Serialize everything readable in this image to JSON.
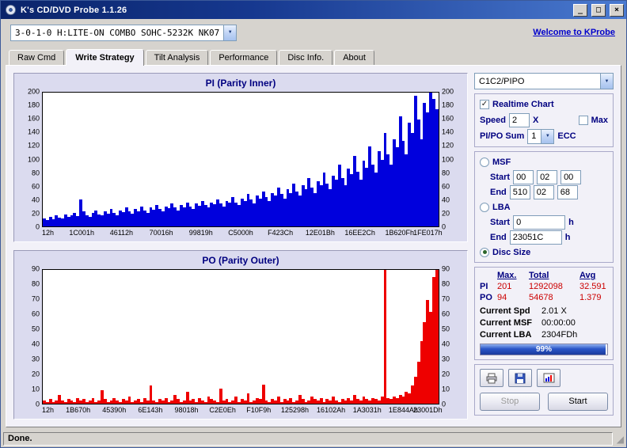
{
  "window": {
    "title": "K's CD/DVD Probe 1.1.26",
    "buttons": {
      "minimize": "_",
      "maximize": "□",
      "close": "×"
    }
  },
  "toolbar": {
    "drive_combo": "3-0-1-0 H:LITE-ON COMBO SOHC-5232K NK07",
    "welcome_link": "Welcome to KProbe"
  },
  "tabs": [
    {
      "label": "Raw Cmd",
      "active": false
    },
    {
      "label": "Write Strategy",
      "active": true
    },
    {
      "label": "Tilt Analysis",
      "active": false
    },
    {
      "label": "Performance",
      "active": false
    },
    {
      "label": "Disc Info.",
      "active": false
    },
    {
      "label": "About",
      "active": false
    }
  ],
  "chart_data": [
    {
      "type": "bar",
      "title": "PI (Parity Inner)",
      "color": "#0000dd",
      "ylim": [
        0,
        200
      ],
      "ytick_step": 20,
      "x_labels": [
        "12h",
        "1C001h",
        "46112h",
        "70016h",
        "99819h",
        "C5000h",
        "F423Ch",
        "12E01Bh",
        "16EE2Ch",
        "1B620Fh",
        "1FE017h"
      ],
      "values": [
        12,
        10,
        14,
        11,
        16,
        13,
        12,
        18,
        14,
        16,
        20,
        15,
        40,
        22,
        17,
        14,
        20,
        24,
        18,
        16,
        22,
        19,
        26,
        20,
        17,
        24,
        21,
        28,
        22,
        19,
        26,
        23,
        30,
        24,
        20,
        28,
        25,
        32,
        26,
        22,
        30,
        27,
        34,
        28,
        24,
        32,
        29,
        36,
        30,
        26,
        34,
        31,
        38,
        32,
        28,
        36,
        33,
        40,
        34,
        30,
        38,
        35,
        44,
        36,
        32,
        42,
        38,
        48,
        40,
        34,
        46,
        42,
        52,
        44,
        38,
        50,
        46,
        58,
        48,
        42,
        56,
        50,
        64,
        52,
        46,
        62,
        56,
        72,
        58,
        50,
        68,
        62,
        80,
        64,
        56,
        76,
        70,
        92,
        72,
        62,
        86,
        78,
        105,
        82,
        70,
        98,
        88,
        120,
        92,
        80,
        112,
        100,
        140,
        108,
        92,
        130,
        118,
        165,
        128,
        108,
        155,
        140,
        195,
        160,
        130,
        185,
        170,
        200,
        190,
        175
      ]
    },
    {
      "type": "bar",
      "title": "PO (Parity Outer)",
      "color": "#ee0000",
      "ylim": [
        0,
        90
      ],
      "ytick_step": 10,
      "x_labels": [
        "12h",
        "1B670h",
        "45390h",
        "6E143h",
        "98018h",
        "C2E0Eh",
        "F10F9h",
        "125298h",
        "16102Ah",
        "1A3031h",
        "1E844Ah",
        "23001Dh"
      ],
      "values": [
        2,
        1,
        3,
        1,
        2,
        6,
        2,
        1,
        3,
        2,
        1,
        4,
        2,
        3,
        1,
        2,
        4,
        1,
        2,
        9,
        3,
        1,
        2,
        4,
        2,
        1,
        3,
        2,
        5,
        1,
        2,
        3,
        1,
        4,
        2,
        12,
        2,
        1,
        3,
        2,
        4,
        1,
        2,
        6,
        3,
        1,
        2,
        8,
        2,
        3,
        1,
        4,
        2,
        1,
        5,
        3,
        2,
        1,
        10,
        2,
        3,
        1,
        2,
        5,
        1,
        3,
        2,
        7,
        1,
        2,
        4,
        3,
        13,
        2,
        1,
        3,
        2,
        5,
        1,
        3,
        2,
        4,
        1,
        2,
        6,
        3,
        1,
        2,
        5,
        3,
        2,
        4,
        1,
        3,
        2,
        5,
        2,
        1,
        3,
        2,
        4,
        2,
        6,
        3,
        2,
        5,
        3,
        2,
        4,
        3,
        2,
        5,
        90,
        4,
        3,
        5,
        4,
        6,
        5,
        8,
        7,
        12,
        18,
        28,
        42,
        55,
        70,
        62,
        85,
        90
      ]
    }
  ],
  "sidebar": {
    "mode_combo": "C1C2/PIPO",
    "realtime_chart": {
      "label": "Realtime Chart",
      "checked": true
    },
    "speed": {
      "label": "Speed",
      "value": "2",
      "unit": "X",
      "max_label": "Max",
      "max_checked": false
    },
    "pipo_sum": {
      "label": "PI/PO Sum",
      "value": "1",
      "unit": "ECC"
    },
    "msf": {
      "label": "MSF",
      "selected": false,
      "start_label": "Start",
      "end_label": "End",
      "start": [
        "00",
        "02",
        "00"
      ],
      "end": [
        "510",
        "02",
        "68"
      ]
    },
    "lba": {
      "label": "LBA",
      "selected": false,
      "start_label": "Start",
      "end_label": "End",
      "start": "0",
      "end": "23051C",
      "unit": "h"
    },
    "disc_size": {
      "label": "Disc Size",
      "selected": true
    },
    "stats": {
      "headers": [
        "Max.",
        "Total",
        "Avg"
      ],
      "rows": [
        {
          "label": "PI",
          "max": "201",
          "total": "1292098",
          "avg": "32.591"
        },
        {
          "label": "PO",
          "max": "94",
          "total": "54678",
          "avg": "1.379"
        }
      ]
    },
    "current": [
      {
        "label": "Current Spd",
        "value": "2.01 X"
      },
      {
        "label": "Current MSF",
        "value": "00:00:00"
      },
      {
        "label": "Current LBA",
        "value": "2304FDh"
      }
    ],
    "progress": {
      "percent": 99,
      "label": "99%"
    },
    "actions": {
      "stop": "Stop",
      "start": "Start"
    }
  },
  "statusbar": {
    "text": "Done."
  }
}
